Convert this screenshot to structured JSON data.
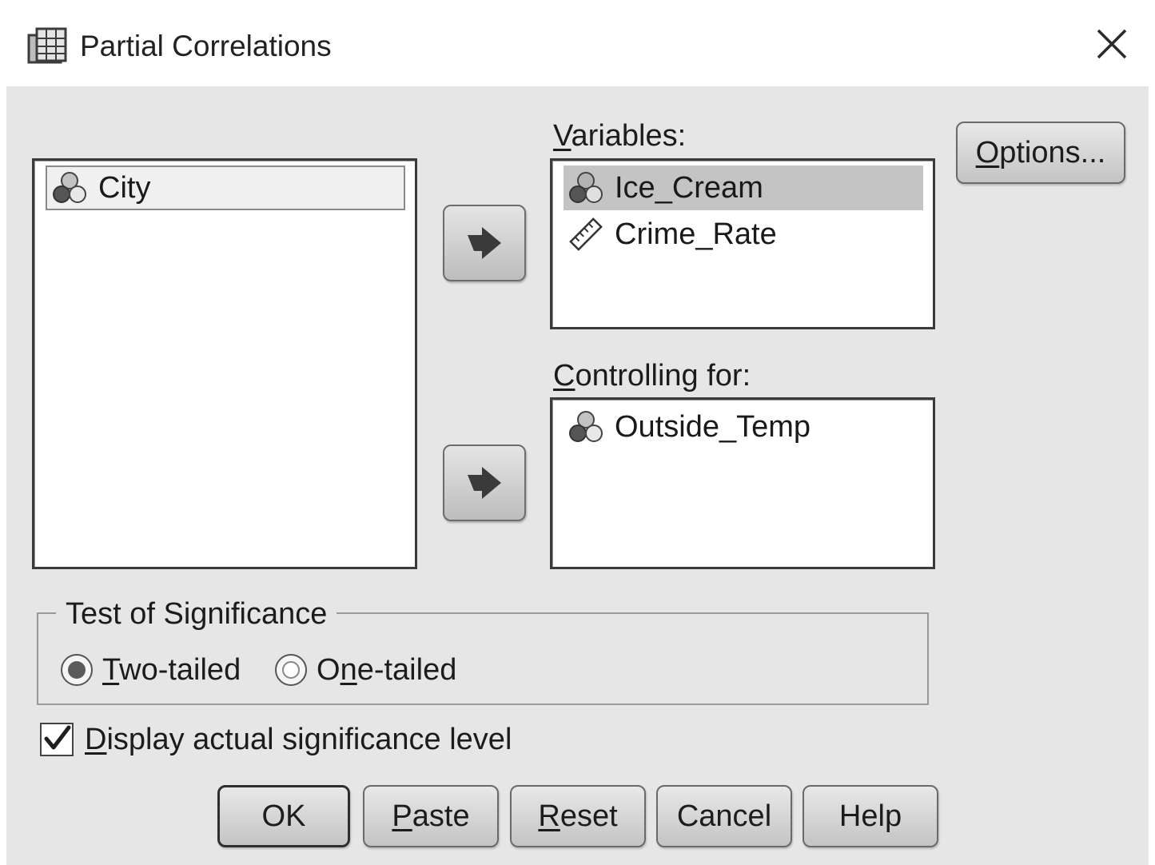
{
  "window": {
    "title": "Partial Correlations",
    "close_icon": "close-icon"
  },
  "source_list": {
    "items": [
      {
        "label": "City",
        "icon": "nominal-variable-icon"
      }
    ]
  },
  "variables": {
    "label_underlined": "V",
    "label_rest": "ariables:",
    "items": [
      {
        "label": "Ice_Cream",
        "icon": "nominal-variable-icon",
        "selected": true
      },
      {
        "label": "Crime_Rate",
        "icon": "scale-variable-icon",
        "selected": false
      }
    ]
  },
  "controlling": {
    "label_underlined": "C",
    "label_rest": "ontrolling for:",
    "items": [
      {
        "label": "Outside_Temp",
        "icon": "nominal-variable-icon"
      }
    ]
  },
  "options_button": {
    "underlined": "O",
    "rest": "ptions..."
  },
  "significance": {
    "legend": "Test of Significance",
    "two_tailed": {
      "before": "",
      "underlined": "T",
      "after": "wo-tailed",
      "checked": true
    },
    "one_tailed": {
      "before": "O",
      "underlined": "n",
      "after": "e-tailed",
      "checked": false
    }
  },
  "display_checkbox": {
    "underlined": "D",
    "rest": "isplay actual significance level",
    "checked": true
  },
  "buttons": {
    "ok": "OK",
    "paste": {
      "underlined": "P",
      "rest": "aste"
    },
    "reset": {
      "underlined": "R",
      "rest": "eset"
    },
    "cancel": "Cancel",
    "help": "Help"
  },
  "colors": {
    "dialog_bg": "#e6e6e6",
    "selection": "#c4c4c4"
  }
}
